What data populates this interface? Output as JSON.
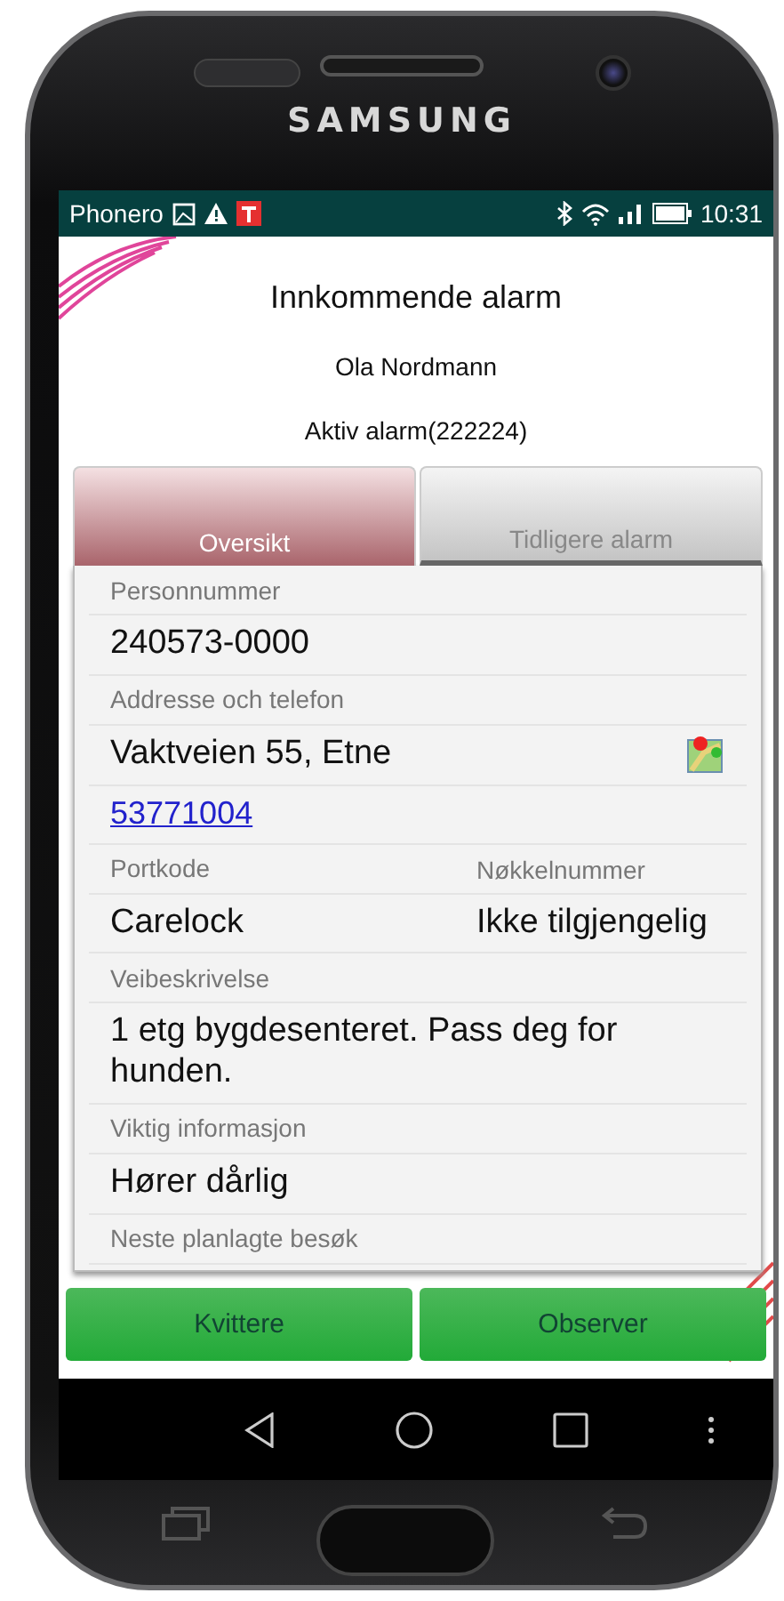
{
  "device": {
    "brand": "SAMSUNG"
  },
  "status_bar": {
    "carrier": "Phonero",
    "time": "10:31"
  },
  "header": {
    "title": "Innkommende alarm",
    "name": "Ola Nordmann",
    "alarm": "Aktiv alarm(222224)"
  },
  "tabs": [
    {
      "label": "Oversikt",
      "selected": true
    },
    {
      "label": "Tidligere alarm",
      "selected": false
    }
  ],
  "fields": [
    {
      "kind": "single",
      "label": "Personnummer",
      "value": "240573-0000"
    },
    {
      "kind": "address",
      "label": "Addresse och telefon",
      "value": "Vaktveien 55, Etne",
      "phone": "53771004"
    },
    {
      "kind": "pair",
      "label": "Portkode",
      "value": "Carelock",
      "label_2": "Nøkkelnummer",
      "value_2": "Ikke tilgjengelig"
    },
    {
      "kind": "single",
      "label": "Veibeskrivelse",
      "value": "1 etg bygdesenteret. Pass deg for hunden."
    },
    {
      "kind": "single",
      "label": "Viktig informasjon",
      "value": "Hører dårlig"
    },
    {
      "kind": "label_only",
      "label": "Neste planlagte besøk"
    }
  ],
  "buttons": [
    "Kvittere",
    "Observer"
  ]
}
